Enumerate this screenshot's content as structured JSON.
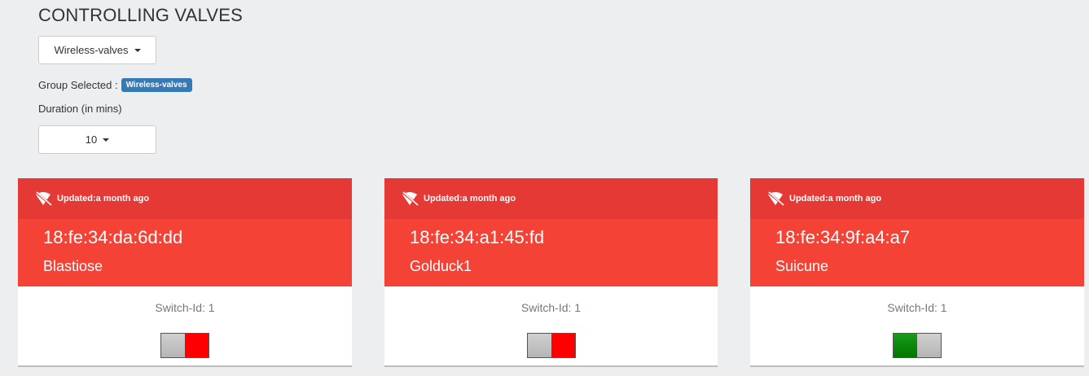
{
  "header": {
    "title": "CONTROLLING VALVES"
  },
  "group_dropdown": {
    "label": "Wireless-valves"
  },
  "group_selected": {
    "label": "Group Selected :",
    "badge": "Wireless-valves"
  },
  "duration": {
    "label": "Duration (in mins)",
    "value": "10"
  },
  "cards": [
    {
      "updated": "Updated:a month ago",
      "mac": "18:fe:34:da:6d:dd",
      "name": "Blastiose",
      "switch": "Switch-Id: 1",
      "state": "off"
    },
    {
      "updated": "Updated:a month ago",
      "mac": "18:fe:34:a1:45:fd",
      "name": "Golduck1",
      "switch": "Switch-Id: 1",
      "state": "off"
    },
    {
      "updated": "Updated:a month ago",
      "mac": "18:fe:34:9f:a4:a7",
      "name": "Suicune",
      "switch": "Switch-Id: 1",
      "state": "on"
    }
  ],
  "icons": {
    "status": "wifi-off-icon"
  },
  "colors": {
    "header_dark": "#e53935",
    "header": "#f44336",
    "badge": "#337ab7",
    "on": "#008800",
    "off": "#ff0000"
  }
}
